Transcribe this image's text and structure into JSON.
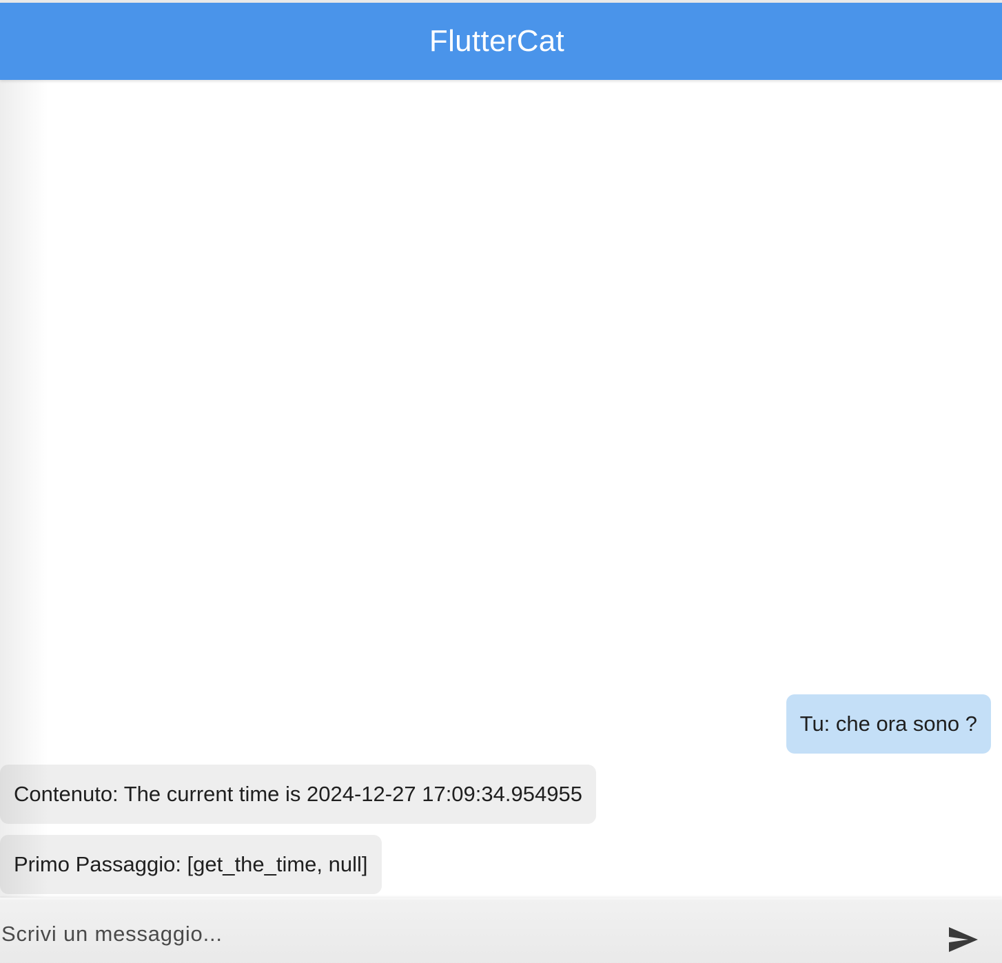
{
  "app_bar": {
    "title": "FlutterCat",
    "color": "#4a94ea"
  },
  "messages": [
    {
      "sender": "user",
      "text": "Tu: che ora sono ?",
      "bubble_color": "#c4dff7"
    },
    {
      "sender": "bot",
      "text": "Contenuto: The current time is 2024-12-27 17:09:34.954955",
      "bubble_color": "#eeeeee"
    },
    {
      "sender": "bot",
      "text": "Primo Passaggio: [get_the_time, null]",
      "bubble_color": "#eeeeee"
    }
  ],
  "composer": {
    "placeholder": "Scrivi un messaggio...",
    "value": "",
    "send_icon": "send-icon"
  }
}
